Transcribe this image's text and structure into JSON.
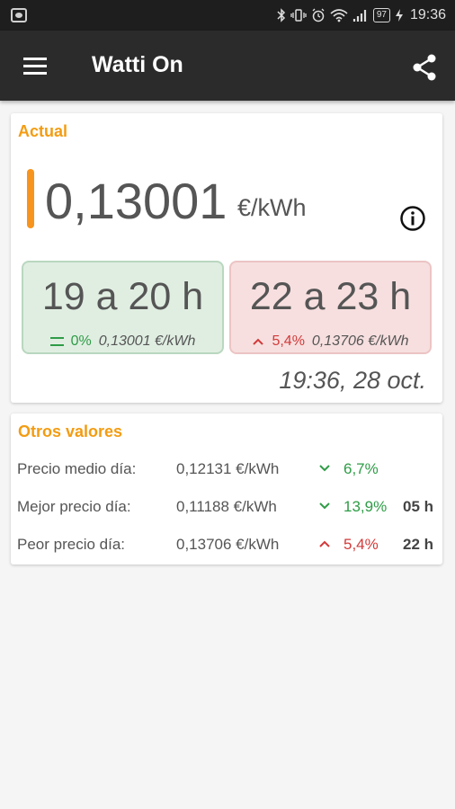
{
  "status_bar": {
    "battery": "97",
    "time": "19:36"
  },
  "app_bar": {
    "title": "Watti On",
    "menu_icon": "hamburger-menu-icon",
    "share_icon": "share-icon"
  },
  "current": {
    "section_title": "Actual",
    "price": "0,13001",
    "unit": "€/kWh",
    "current_slot": {
      "hours": "19 a 20 h",
      "change": "0%",
      "price": "0,13001 €/kWh"
    },
    "next_slot": {
      "hours": "22 a 23 h",
      "change": "5,4%",
      "price": "0,13706 €/kWh"
    },
    "timestamp": "19:36, 28 oct."
  },
  "others": {
    "section_title": "Otros valores",
    "rows": [
      {
        "label": "Precio medio día:",
        "value": "0,12131 €/kWh",
        "trend": "down",
        "pct": "6,7%",
        "hour": ""
      },
      {
        "label": "Mejor precio día:",
        "value": "0,11188 €/kWh",
        "trend": "down",
        "pct": "13,9%",
        "hour": "05 h"
      },
      {
        "label": "Peor precio día:",
        "value": "0,13706 €/kWh",
        "trend": "up",
        "pct": "5,4%",
        "hour": "22 h"
      }
    ]
  },
  "colors": {
    "accent": "#f39c12",
    "green": "#2e9c46",
    "red": "#d23a3a",
    "appbar": "#2b2b2b"
  }
}
